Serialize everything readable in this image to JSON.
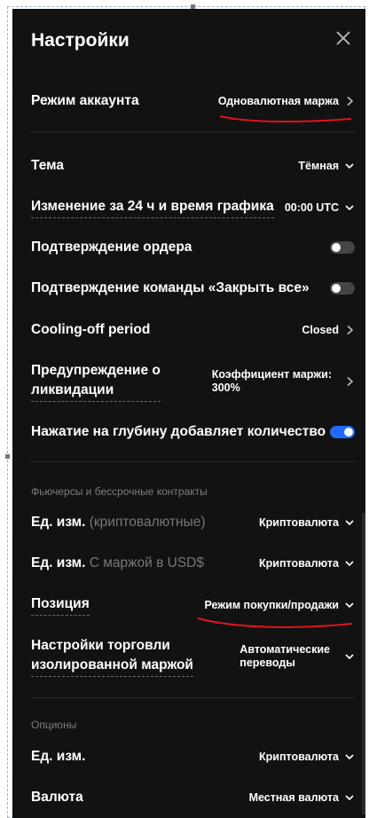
{
  "header": {
    "title": "Настройки"
  },
  "account_mode": {
    "label": "Режим аккаунта",
    "value": "Одновалютная маржа"
  },
  "settings": {
    "theme": {
      "label": "Тема",
      "value": "Тёмная"
    },
    "change24h": {
      "label": "Изменение за 24 ч и время графика",
      "value": "00:00 UTC"
    },
    "order_confirm": {
      "label": "Подтверждение ордера",
      "enabled": false
    },
    "close_all_confirm": {
      "label": "Подтверждение команды «Закрыть все»",
      "enabled": false
    },
    "cooling_off": {
      "label": "Cooling-off period",
      "value": "Closed"
    },
    "liquidation_warning": {
      "label_line1": "Предупреждение о",
      "label_line2": "ликвидации",
      "value_line1": "Коэффициент маржи:",
      "value_line2": "300%"
    },
    "depth_tap": {
      "label": "Нажатие на глубину добавляет количество",
      "enabled": true
    }
  },
  "futures": {
    "section_title": "Фьючерсы и бессрочные контракты",
    "unit_crypto": {
      "label": "Ед. изм.",
      "label_muted": "(криптовалютные)",
      "value": "Криптовалюта"
    },
    "unit_usd": {
      "label": "Ед. изм.",
      "label_muted": "С маржой в USD$",
      "value": "Криптовалюта"
    },
    "position": {
      "label": "Позиция",
      "value": "Режим покупки/продажи"
    },
    "isolated": {
      "label_line1": "Настройки торговли",
      "label_line2": "изолированной маржой",
      "value_line1": "Автоматические",
      "value_line2": "переводы"
    }
  },
  "options": {
    "section_title": "Опционы",
    "unit": {
      "label": "Ед. изм.",
      "value": "Криптовалюта"
    },
    "currency": {
      "label": "Валюта",
      "value": "Местная валюта"
    }
  },
  "colors": {
    "background": "#121212",
    "accent": "#1f6bff",
    "annotation": "#e0141e"
  }
}
